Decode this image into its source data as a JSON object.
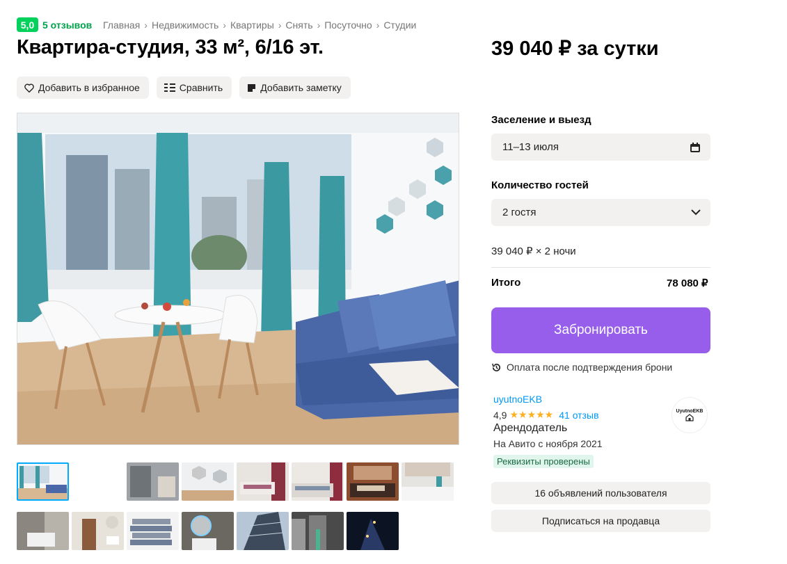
{
  "header": {
    "rating": "5,0",
    "reviews": "5 отзывов",
    "breadcrumbs": [
      "Главная",
      "Недвижимость",
      "Квартиры",
      "Снять",
      "Посуточно",
      "Студии"
    ],
    "title": "Квартира-студия, 33 м², 6/16 эт.",
    "price": "39 040 ₽ за сутки"
  },
  "actions": {
    "favorite": "Добавить в избранное",
    "compare": "Сравнить",
    "note": "Добавить заметку"
  },
  "booking": {
    "checkin_label": "Заселение и выезд",
    "dates": "11–13 июля",
    "guests_label": "Количество гостей",
    "guests": "2 гостя",
    "calc": "39 040 ₽ × 2 ночи",
    "total_label": "Итого",
    "total": "78 080 ₽",
    "book_button": "Забронировать",
    "pay_note": "Оплата после подтверждения брони"
  },
  "seller": {
    "name": "uyutnoEKB",
    "rating": "4,9",
    "stars": "★★★★★",
    "reviews": "41 отзыв",
    "role": "Арендодатель",
    "since": "На Авито с ноября 2021",
    "verified": "Реквизиты проверены",
    "avatar_text": "UyutnoEKB",
    "listings_button": "16 объявлений пользователя",
    "subscribe_button": "Подписаться на продавца"
  },
  "colors": {
    "accent": "#965eeb",
    "rating_green": "#02d15c",
    "link_blue": "#0099f7"
  }
}
